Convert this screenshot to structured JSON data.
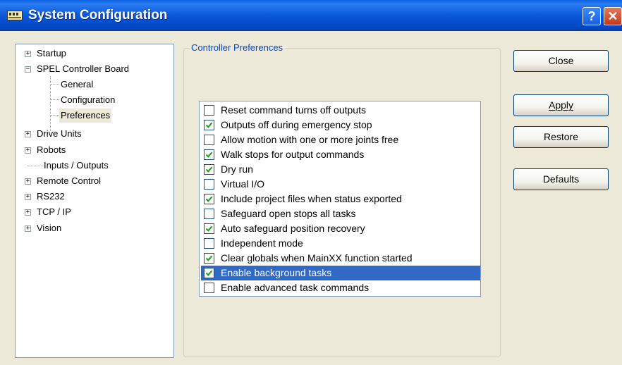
{
  "window": {
    "title": "System Configuration",
    "help_label": "?",
    "close_label": "✕"
  },
  "tree": {
    "items": [
      {
        "label": "Startup",
        "expander": "+"
      },
      {
        "label": "SPEL Controller Board",
        "expander": "−"
      },
      {
        "label": "General"
      },
      {
        "label": "Configuration"
      },
      {
        "label": "Preferences",
        "selected": true
      },
      {
        "label": "Drive Units",
        "expander": "+"
      },
      {
        "label": "Robots",
        "expander": "+"
      },
      {
        "label": "Inputs / Outputs"
      },
      {
        "label": "Remote Control",
        "expander": "+"
      },
      {
        "label": "RS232",
        "expander": "+"
      },
      {
        "label": "TCP / IP",
        "expander": "+"
      },
      {
        "label": "Vision",
        "expander": "+"
      }
    ]
  },
  "preferences": {
    "group_title": "Controller Preferences",
    "items": [
      {
        "label": "Reset command turns off outputs",
        "checked": false
      },
      {
        "label": "Outputs off during emergency stop",
        "checked": true
      },
      {
        "label": "Allow motion with one or more joints free",
        "checked": false
      },
      {
        "label": "Walk stops for output commands",
        "checked": true
      },
      {
        "label": "Dry run",
        "checked": true
      },
      {
        "label": "Virtual I/O",
        "checked": false
      },
      {
        "label": "Include project files when status exported",
        "checked": true
      },
      {
        "label": "Safeguard open stops all tasks",
        "checked": false
      },
      {
        "label": "Auto safeguard position recovery",
        "checked": true
      },
      {
        "label": "Independent mode",
        "checked": false
      },
      {
        "label": "Clear globals when MainXX function started",
        "checked": true
      },
      {
        "label": "Enable background tasks",
        "checked": true,
        "highlighted": true
      },
      {
        "label": "Enable advanced task commands",
        "checked": false
      }
    ]
  },
  "buttons": {
    "close": "Close",
    "apply": "Apply",
    "restore": "Restore",
    "defaults": "Defaults"
  },
  "colors": {
    "titlebar": "#0a58d8",
    "selection": "#316ac5",
    "group_title": "#0046d5",
    "check": "#21a121"
  }
}
